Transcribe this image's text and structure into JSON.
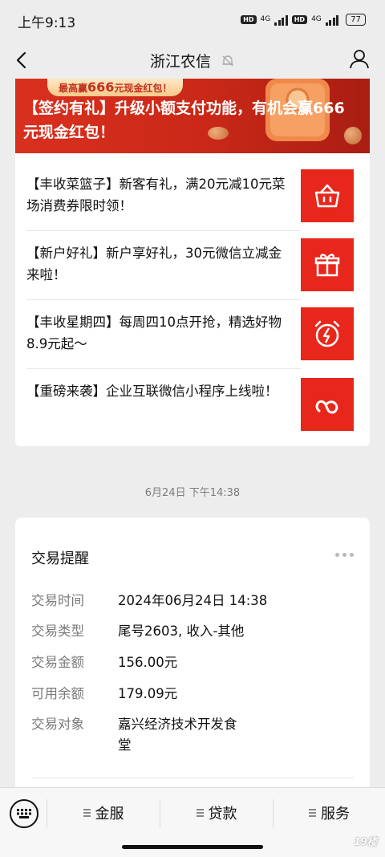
{
  "status_bar": {
    "time": "上午9:13",
    "hd1": "HD",
    "net1": "4G",
    "hd2": "HD",
    "net2": "4G",
    "battery": "77"
  },
  "nav": {
    "title": "浙江农信"
  },
  "article": {
    "banner_badge_prefix": "最高赢",
    "banner_badge_amount": "666",
    "banner_badge_suffix": "元现金红包！",
    "banner_title": "【签约有礼】升级小额支付功能，有机会赢666元现金红包！",
    "items": [
      {
        "title": "【丰收菜篮子】新客有礼，满20元减10元菜场消费券限时领！",
        "icon": "basket-icon"
      },
      {
        "title": "【新户好礼】新户享好礼，30元微信立减金来啦！",
        "icon": "gift-icon"
      },
      {
        "title": "【丰收星期四】每周四10点开抢，精选好物8.9元起～",
        "icon": "alarm-clock-icon"
      },
      {
        "title": "【重磅来袭】企业互联微信小程序上线啦！",
        "icon": "mini-program-icon"
      }
    ]
  },
  "timestamp": "6月24日 下午14:38",
  "transaction": {
    "title": "交易提醒",
    "rows": [
      {
        "label": "交易时间",
        "value": "2024年06月24日 14:38"
      },
      {
        "label": "交易类型",
        "value": "尾号2603, 收入-其他"
      },
      {
        "label": "交易金额",
        "value": "156.00元"
      },
      {
        "label": "可用余额",
        "value": "179.09元"
      },
      {
        "label": "交易对象",
        "value": "嘉兴经济技术开发食堂"
      }
    ]
  },
  "bottom_menu": {
    "items": [
      "金服",
      "贷款",
      "服务"
    ]
  },
  "watermark": "19楼",
  "colors": {
    "brand_red": "#e8271c",
    "banner_red": "#d9301e",
    "background": "#ededed"
  }
}
